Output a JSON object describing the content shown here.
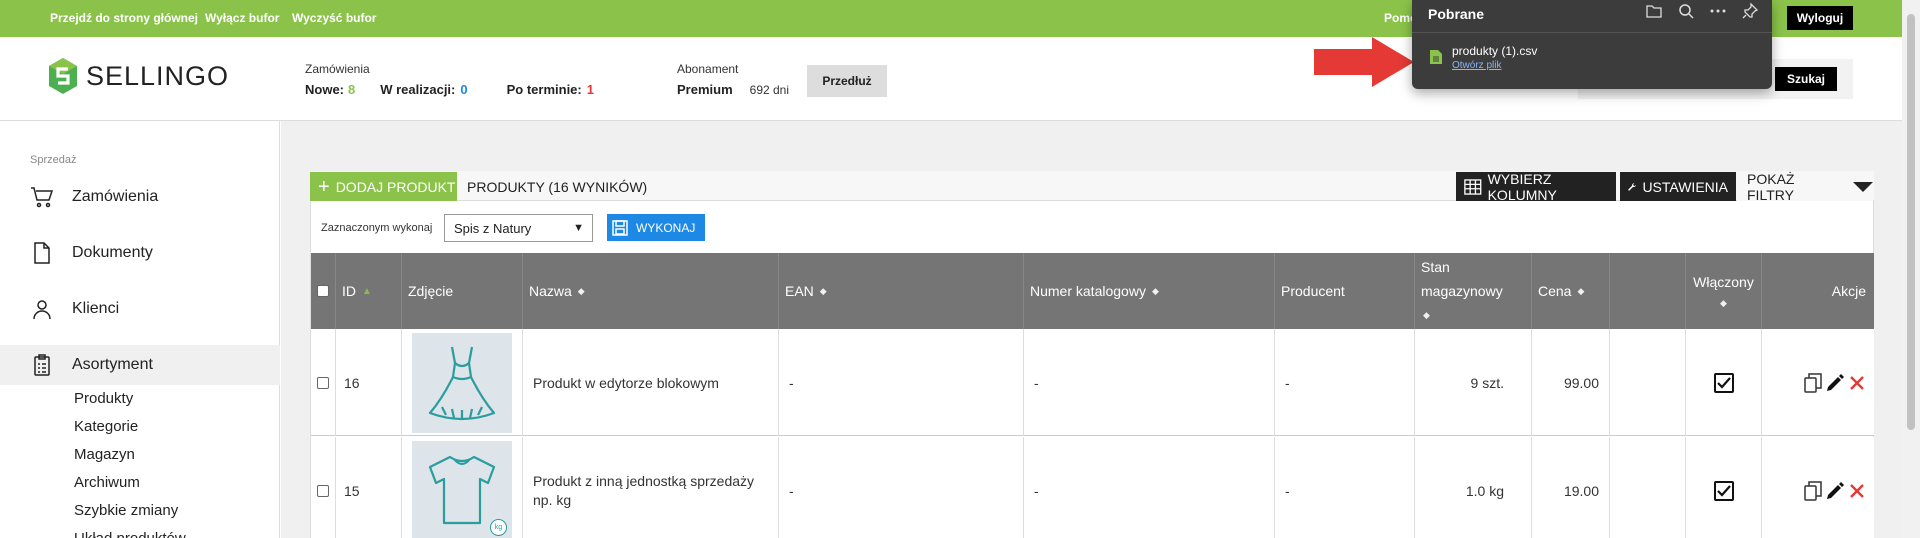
{
  "topbar": {
    "links": [
      "Przejdź do strony głównej",
      "Wyłącz bufor",
      "Wyczyść bufor"
    ],
    "help_partial": "Pomo",
    "logout": "Wyloguj"
  },
  "header": {
    "logo": "SELLINGO",
    "orders": {
      "label": "Zamówienia",
      "new_label": "Nowe:",
      "new_value": "8",
      "inprogress_label": "W realizacji:",
      "inprogress_value": "0",
      "overdue_label": "Po terminie:",
      "overdue_value": "1"
    },
    "subscription": {
      "label": "Abonament",
      "plan": "Premium",
      "days": "692 dni",
      "extend_button": "Przedłuż"
    },
    "search_button": "Szukaj"
  },
  "sidebar": {
    "section": "Sprzedaż",
    "items": [
      {
        "label": "Zamówienia",
        "icon": "cart-icon"
      },
      {
        "label": "Dokumenty",
        "icon": "document-icon"
      },
      {
        "label": "Klienci",
        "icon": "user-icon"
      },
      {
        "label": "Asortyment",
        "icon": "clipboard-icon"
      }
    ],
    "subitems": [
      "Produkty",
      "Kategorie",
      "Magazyn",
      "Archiwum",
      "Szybkie zmiany",
      "Układ produktów"
    ]
  },
  "toolbar": {
    "add_product": "DODAJ PRODUKT",
    "product_count": "PRODUKTY (16 WYNIKÓW)",
    "choose_columns": "WYBIERZ KOLUMNY",
    "settings": "USTAWIENIA",
    "show_filters": "POKAŻ FILTRY"
  },
  "bulk": {
    "label": "Zaznaczonym wykonaj",
    "selected": "Spis z Natury",
    "execute": "WYKONAJ"
  },
  "table": {
    "headers": {
      "id": "ID",
      "photo": "Zdjęcie",
      "name": "Nazwa",
      "ean": "EAN",
      "catalog": "Numer katalogowy",
      "producer": "Producent",
      "stock_line1": "Stan",
      "stock_line2": "magazynowy",
      "price": "Cena",
      "enabled": "Włączony",
      "actions": "Akcje"
    },
    "rows": [
      {
        "id": "16",
        "name": "Produkt w edytorze blokowym",
        "ean": "-",
        "catalog": "-",
        "producer": "-",
        "stock": "9 szt.",
        "price": "99.00",
        "image": "dress-icon",
        "enabled": true
      },
      {
        "id": "15",
        "name": "Produkt z inną jednostką sprzedaży np. kg",
        "ean": "-",
        "catalog": "-",
        "producer": "-",
        "stock": "1.0 kg",
        "price": "19.00",
        "image": "tshirt-icon",
        "badge": "kg",
        "enabled": true
      }
    ]
  },
  "downloads": {
    "title": "Pobrane",
    "filename": "produkty (1).csv",
    "open": "Otwórz plik"
  },
  "colors": {
    "brand_green": "#8bc34a",
    "accent_blue": "#1e88e5",
    "table_header": "#757575",
    "popup_bg": "#3c3c3c",
    "arrow_red": "#e53935"
  }
}
